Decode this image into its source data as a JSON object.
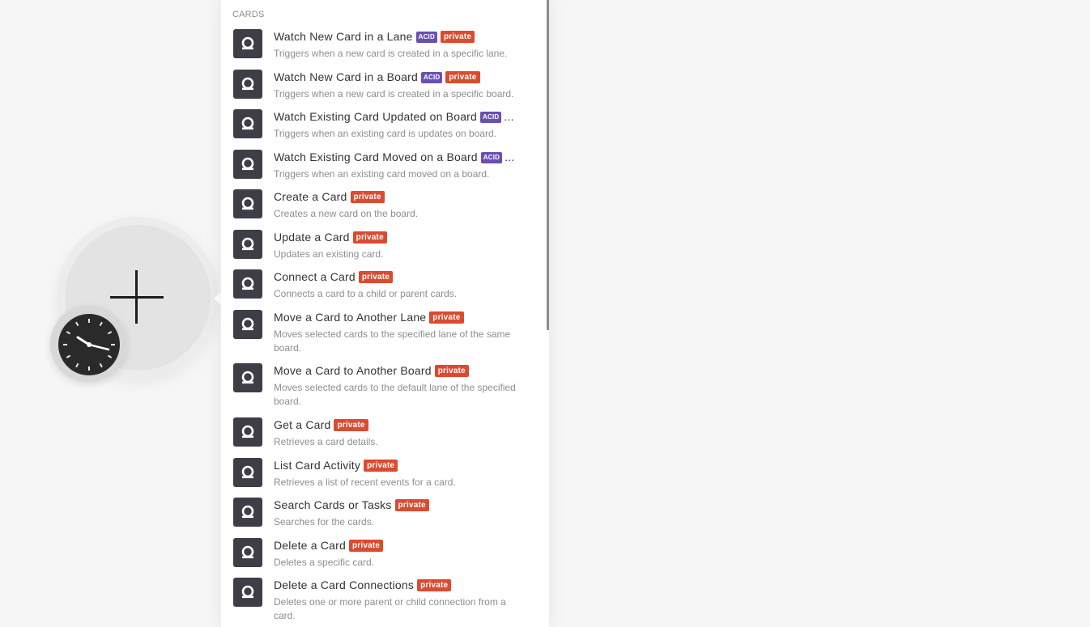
{
  "panel": {
    "section_title": "CARDS",
    "items": [
      {
        "title": "Watch New Card in a Lane",
        "acid": "ACID",
        "private": "private",
        "desc": "Triggers when a new card is created in a specific lane."
      },
      {
        "title": "Watch New Card in a Board",
        "acid": "ACID",
        "private": "private",
        "desc": "Triggers when a new card is created in a specific board."
      },
      {
        "title": "Watch Existing Card Updated on Board",
        "acid": "ACID",
        "ellipsis": "...",
        "desc": "Triggers when an existing card is updates on board."
      },
      {
        "title": "Watch Existing Card Moved on a Board",
        "acid": "ACID",
        "ellipsis": "...",
        "desc": "Triggers when an existing card moved on a board."
      },
      {
        "title": "Create a Card",
        "private": "private",
        "desc": "Creates a new card on the board."
      },
      {
        "title": "Update a Card",
        "private": "private",
        "desc": "Updates an existing card."
      },
      {
        "title": "Connect a Card",
        "private": "private",
        "desc": "Connects a card to a child or parent cards."
      },
      {
        "title": "Move a Card to Another Lane",
        "private": "private",
        "desc": "Moves selected cards to the specified lane of the same board."
      },
      {
        "title": "Move a Card to Another Board",
        "private": "private",
        "desc": "Moves selected cards to the default lane of the specified board."
      },
      {
        "title": "Get a Card",
        "private": "private",
        "desc": "Retrieves a card details."
      },
      {
        "title": "List Card Activity",
        "private": "private",
        "desc": "Retrieves a list of recent events for a card."
      },
      {
        "title": "Search Cards or Tasks",
        "private": "private",
        "desc": "Searches for the cards."
      },
      {
        "title": "Delete a Card",
        "private": "private",
        "desc": "Deletes a specific card."
      },
      {
        "title": "Delete a Card Connections",
        "private": "private",
        "desc": "Deletes one or more parent or child connection from a card."
      }
    ]
  },
  "canvas": {
    "module_icon": "plus-icon",
    "trigger_icon": "clock-icon"
  },
  "colors": {
    "acid_badge": "#6a4fb3",
    "private_badge": "#db4b30",
    "app_icon_bg": "#3e3e46"
  }
}
